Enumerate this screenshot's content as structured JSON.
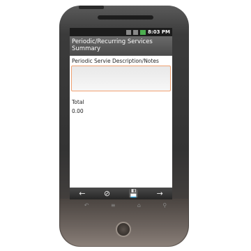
{
  "status": {
    "time": "8:03 PM"
  },
  "screen": {
    "title": "Periodic/Recurring Services Summary",
    "description_label": "Periodic Servie Description/Notes",
    "description_value": "",
    "total_label": "Total",
    "total_value": "0.00"
  },
  "toolbar": {
    "back_icon": "←",
    "cancel_icon": "⊘",
    "save_icon": "💾",
    "forward_icon": "→"
  },
  "navkeys": {
    "back": "↶",
    "menu": "≡",
    "home": "⌂",
    "search": "⚲"
  },
  "colors": {
    "field_border": "#f0a070",
    "titlebar": "#5a5a5a"
  }
}
